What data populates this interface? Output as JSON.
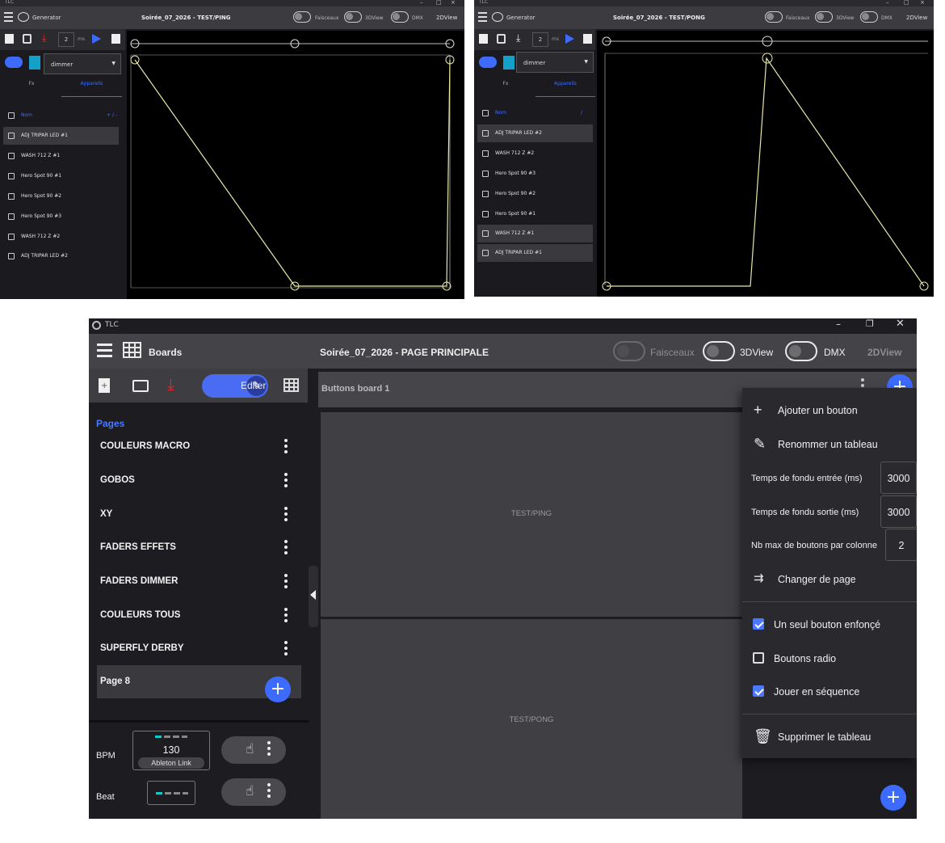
{
  "gen_left": {
    "app_name": "Generator",
    "title": "Soirée_07_2026 - TEST/PING",
    "toggles": [
      "Faisceaux",
      "3DView",
      "DMX"
    ],
    "view_2d": "2DView",
    "page_number": "2",
    "dropdown": "dimmer",
    "tabs": [
      "Fx",
      "Appareils"
    ],
    "list_header": "Nom",
    "list_header_extra": "+ / -",
    "devices": [
      "ADJ TRIPAR LED #1",
      "WASH 712 Z #1",
      "Hero Spot 90 #1",
      "Hero Spot 90 #2",
      "Hero Spot 90 #3",
      "WASH 712 Z #2",
      "ADJ TRIPAR LED #2"
    ]
  },
  "gen_right": {
    "app_name": "Generator",
    "title": "Soirée_07_2026 - TEST/PONG",
    "toggles": [
      "Faisceaux",
      "3DView",
      "DMX"
    ],
    "view_2d": "2DView",
    "page_number": "2",
    "dropdown": "dimmer",
    "tabs": [
      "Fx",
      "Appareils"
    ],
    "list_header": "Nom",
    "list_header_extra": "/",
    "devices": [
      "ADJ TRIPAR LED #2",
      "WASH 712 Z #2",
      "Hero Spot 90 #3",
      "Hero Spot 90 #2",
      "Hero Spot 90 #1",
      "WASH 712 Z #1",
      "ADJ TRIPAR LED #1"
    ]
  },
  "main": {
    "window_title": "TLC",
    "section": "Boards",
    "title": "Soirée_07_2026 - PAGE PRINCIPALE",
    "toggles": {
      "faisceaux": "Faisceaux",
      "view3d": "3DView",
      "dmx": "DMX"
    },
    "view_2d": "2DView",
    "edit_label": "Editer",
    "pages_heading": "Pages",
    "pages": [
      "COULEURS MACRO",
      "GOBOS",
      "XY",
      "FADERS EFFETS",
      "FADERS DIMMER",
      "COULEURS TOUS",
      "SUPERFLY DERBY",
      "Page 8"
    ],
    "bpm_label": "BPM",
    "bpm_value": "130",
    "bpm_source": "Ableton Link",
    "beat_label": "Beat",
    "board_title": "Buttons board 1",
    "buttons": [
      "TEST/PING",
      "TEST/PONG"
    ]
  },
  "context_menu": {
    "add_button": "Ajouter un bouton",
    "rename_board": "Renommer un tableau",
    "fade_in_label": "Temps de fondu entrée (ms)",
    "fade_in_value": "3000",
    "fade_out_label": "Temps de fondu sortie (ms)",
    "fade_out_value": "3000",
    "max_buttons_label": "Nb max de boutons par colonne",
    "max_buttons_value": "2",
    "change_page": "Changer de page",
    "single_pressed": "Un seul bouton enfonçé",
    "single_pressed_checked": true,
    "radio_buttons": "Boutons radio",
    "radio_buttons_checked": false,
    "play_sequence": "Jouer en séquence",
    "play_sequence_checked": true,
    "delete_board": "Supprimer le tableau"
  },
  "colors": {
    "accent": "#3d6bff",
    "curve": "#e8e8a8",
    "panel": "#1d1d21",
    "header": "#444448"
  }
}
